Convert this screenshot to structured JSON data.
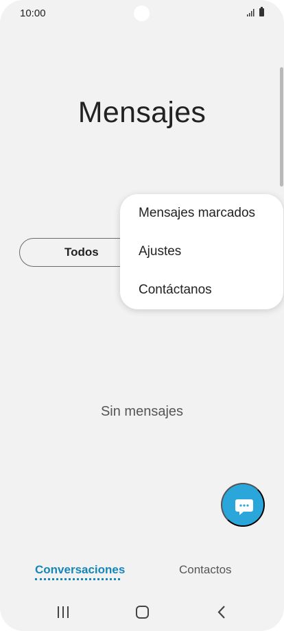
{
  "status_bar": {
    "time": "10:00",
    "icons": [
      "camera-cutout-icon",
      "signal-icon",
      "battery-icon"
    ]
  },
  "header": {
    "title": "Mensajes"
  },
  "filter": {
    "selected_label": "Todos"
  },
  "overflow_menu": {
    "items": [
      {
        "label": "Mensajes marcados"
      },
      {
        "label": "Ajustes"
      },
      {
        "label": "Contáctanos"
      }
    ]
  },
  "empty_state": {
    "text": "Sin mensajes"
  },
  "fab": {
    "icon": "new-message-icon",
    "color": "#2aa6db"
  },
  "tabs": [
    {
      "label": "Conversaciones",
      "active": true
    },
    {
      "label": "Contactos",
      "active": false
    }
  ],
  "colors": {
    "accent": "#1686b8",
    "background": "#f2f2f2",
    "fab": "#2aa6db"
  },
  "navigation_bar": {
    "icons": [
      "recent-apps-icon",
      "home-icon",
      "back-icon"
    ]
  }
}
